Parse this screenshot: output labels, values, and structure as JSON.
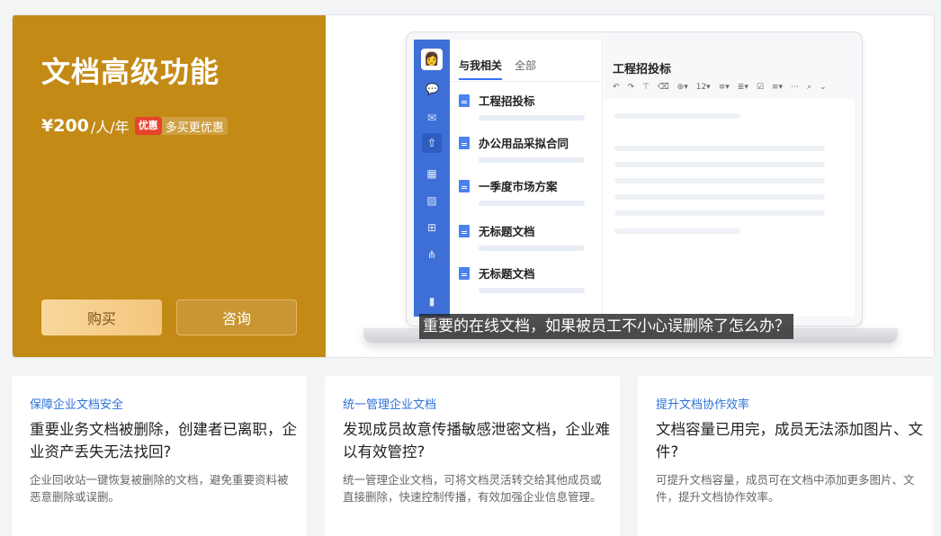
{
  "hero": {
    "title": "文档高级功能",
    "price": "¥200",
    "unit": "/人/年",
    "promo_tag": "优惠",
    "promo_text": "多买更优惠",
    "buy_label": "购买",
    "consult_label": "咨询",
    "caption": "重要的在线文档，如果被员工不小心误删除了怎么办？"
  },
  "mockup": {
    "tabs": [
      "与我相关",
      "全部"
    ],
    "documents": [
      "工程招投标",
      "办公用品采拟合同",
      "一季度市场方案",
      "无标题文档",
      "无标题文档"
    ],
    "editor_title": "工程招投标",
    "toolbar": [
      "↶",
      "↷",
      "⊤",
      "⌫",
      "⊛▾",
      "12▾",
      "≡▾",
      "≣▾",
      "☑",
      "≡▾",
      "⋯",
      "⌕",
      "⌄"
    ],
    "rail_icons": [
      "chat-icon",
      "mail-icon",
      "doc-upload-icon",
      "calendar-icon",
      "image-icon",
      "apps-icon",
      "org-chart-icon",
      "chart-icon"
    ]
  },
  "cards": [
    {
      "label": "保障企业文档安全",
      "title": "重要业务文档被删除，创建者已离职，企业资产丢失无法找回?",
      "desc": "企业回收站一键恢复被删除的文档，避免重要资料被恶意删除或误删。"
    },
    {
      "label": "统一管理企业文档",
      "title": "发现成员故意传播敏感泄密文档，企业难以有效管控?",
      "desc": "统一管理企业文档，可将文档灵活转交给其他成员或直接删除，快速控制传播，有效加强企业信息管理。"
    },
    {
      "label": "提升文档协作效率",
      "title": "文档容量已用完，成员无法添加图片、文件?",
      "desc": "可提升文档容量，成员可在文档中添加更多图片、文件，提升文档协作效率。"
    }
  ],
  "colors": {
    "hero_gold": "#c48a16",
    "accent_blue": "#2d72d9",
    "promo_red": "#e9422f"
  }
}
